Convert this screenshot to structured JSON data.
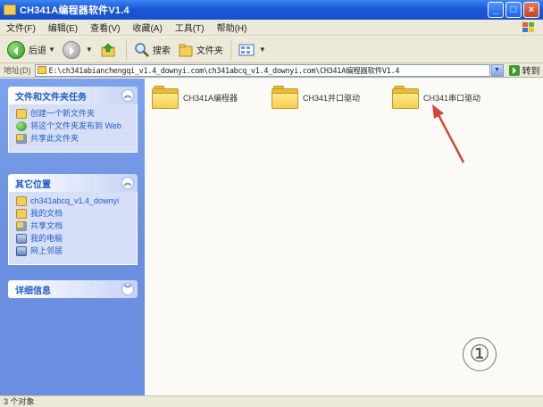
{
  "window": {
    "title": "CH341A编程器软件V1.4",
    "buttons": {
      "minimize": "_",
      "maximize": "□",
      "close": "×"
    }
  },
  "menu": [
    "文件(F)",
    "编辑(E)",
    "查看(V)",
    "收藏(A)",
    "工具(T)",
    "帮助(H)"
  ],
  "toolbar": {
    "back_label": "后退",
    "search_label": "搜索",
    "folders_label": "文件夹"
  },
  "address": {
    "label": "地址(D)",
    "path": "E:\\ch341abianchengqi_v1.4_downyi.com\\ch341abcq_v1.4_downyi.com\\CH341A编程器软件V1.4",
    "go_label": "转到"
  },
  "taskpane": {
    "file_tasks": {
      "title": "文件和文件夹任务",
      "items": [
        "创建一个新文件夹",
        "将这个文件夹发布到 Web",
        "共享此文件夹"
      ]
    },
    "other_places": {
      "title": "其它位置",
      "items": [
        "ch341abcq_v1.4_downyi",
        "我的文档",
        "共享文档",
        "我的电脑",
        "网上邻居"
      ]
    },
    "details": {
      "title": "详细信息"
    }
  },
  "files": [
    {
      "name": "CH341A编程器"
    },
    {
      "name": "CH341并口驱动"
    },
    {
      "name": "CH341串口驱动"
    }
  ],
  "annotation": {
    "marker": "①"
  },
  "status": {
    "text": "3 个对象"
  }
}
